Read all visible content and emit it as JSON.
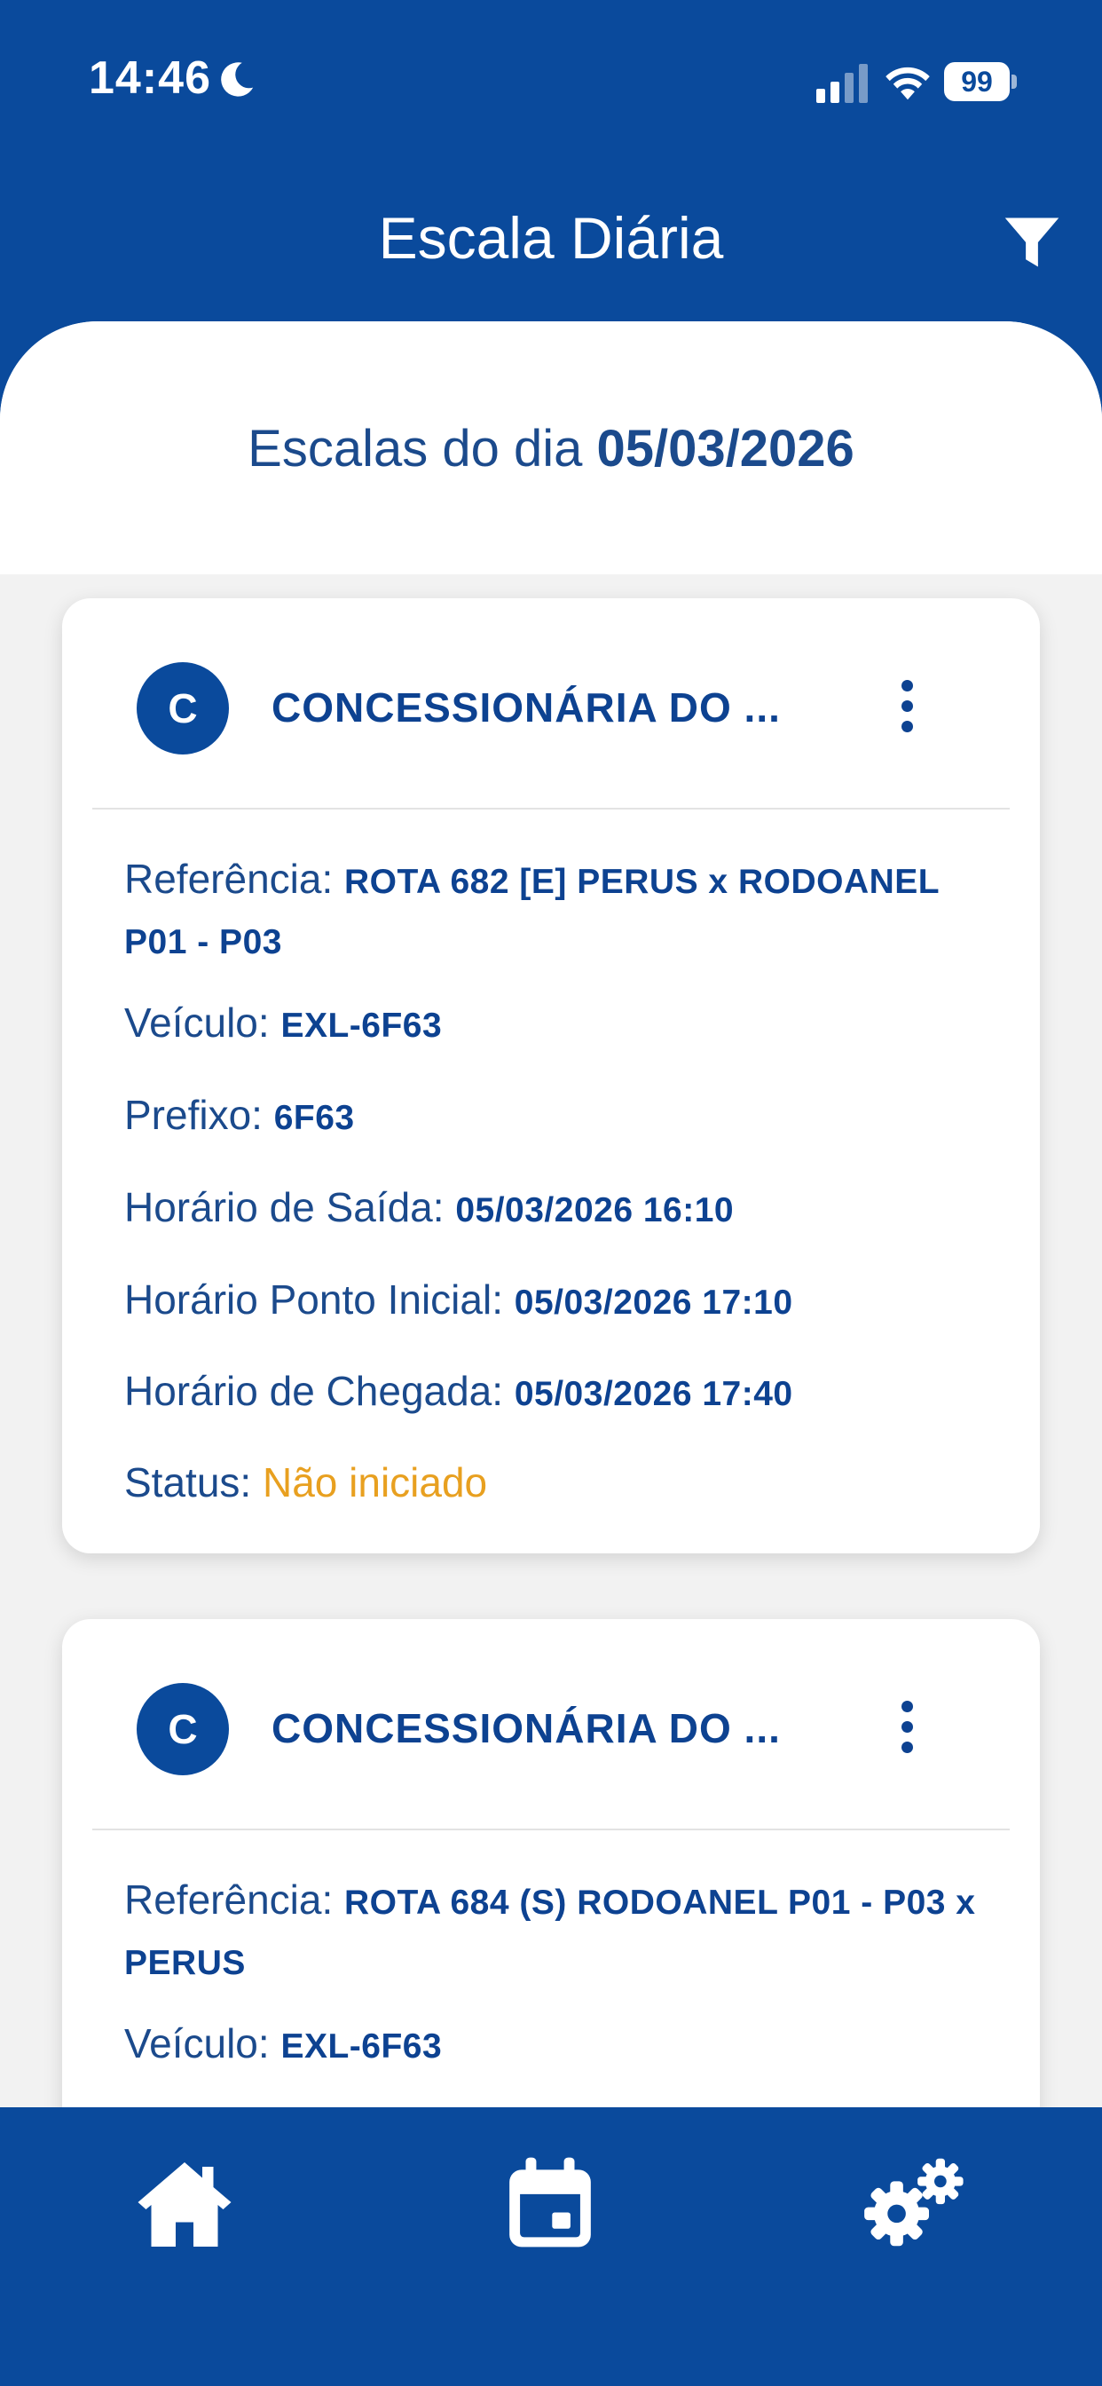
{
  "status_bar": {
    "time": "14:46",
    "battery": "99"
  },
  "header": {
    "title": "Escala Diária"
  },
  "date_header": {
    "prefix": "Escalas do dia",
    "date": "05/03/2026"
  },
  "cards": [
    {
      "avatar": "C",
      "title": "CONCESSIONÁRIA DO ...",
      "fields": [
        {
          "label": "Referência: ",
          "value": "ROTA 682 [E] PERUS x RODOANEL P01 - P03"
        },
        {
          "label": "Veículo: ",
          "value": "EXL-6F63"
        },
        {
          "label": "Prefixo: ",
          "value": "6F63"
        },
        {
          "label": "Horário de Saída: ",
          "value": "05/03/2026 16:10"
        },
        {
          "label": "Horário Ponto Inicial: ",
          "value": "05/03/2026 17:10"
        },
        {
          "label": "Horário de Chegada: ",
          "value": "05/03/2026 17:40"
        },
        {
          "label": "Status: ",
          "value": "Não iniciado"
        }
      ]
    },
    {
      "avatar": "C",
      "title": "CONCESSIONÁRIA DO ...",
      "fields": [
        {
          "label": "Referência: ",
          "value": "ROTA 684 (S) RODOANEL P01 - P03 x PERUS"
        },
        {
          "label": "Veículo: ",
          "value": "EXL-6F63"
        }
      ]
    }
  ],
  "colors": {
    "brand": "#0a4a9c",
    "status_pending": "#e8a020"
  },
  "icons": {
    "filter": "filter-icon",
    "home": "home-icon",
    "calendar": "calendar-icon",
    "settings": "settings-gears-icon"
  }
}
